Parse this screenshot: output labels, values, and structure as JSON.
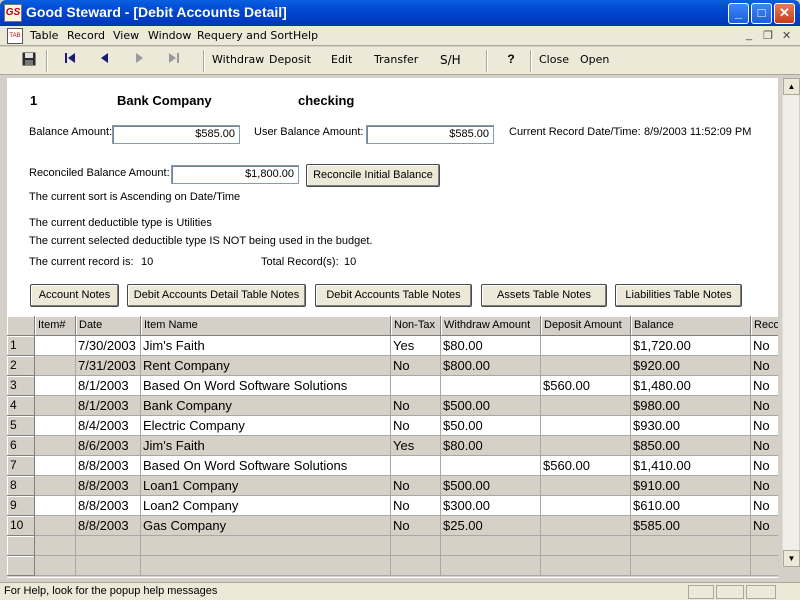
{
  "window": {
    "title": "Good Steward - [Debit Accounts Detail]",
    "icon_text": "GS"
  },
  "menu": [
    "Table",
    "Record",
    "View",
    "Window",
    "Requery and Sort",
    "Help"
  ],
  "toolbar": {
    "withdraw": "Withdraw",
    "deposit": "Deposit",
    "edit": "Edit",
    "transfer": "Transfer",
    "sh": "S/H",
    "close": "Close",
    "open": "Open"
  },
  "header": {
    "record_no": "1",
    "account_name": "Bank Company",
    "account_type": "checking"
  },
  "balances": {
    "balance_label": "Balance Amount:",
    "balance_value": "$585.00",
    "user_balance_label": "User Balance Amount:",
    "user_balance_value": "$585.00",
    "current_date_label": "Current Record Date/Time:",
    "current_date_value": "8/9/2003 11:52:09 PM",
    "reconciled_label": "Reconciled Balance Amount:",
    "reconciled_value": "$1,800.00",
    "reconcile_button": "Reconcile Initial Balance"
  },
  "info": {
    "sort_prefix": "The current sort is",
    "sort_order": "Ascending",
    "sort_on": "on",
    "sort_field": "Date/Time",
    "deductible_prefix": "The current deductible type is",
    "deductible_type": "Utilities",
    "budget_note": "The current selected deductible type IS NOT being used in the budget.",
    "current_record_label": "The current record is:",
    "current_record_value": "10",
    "total_records_label": "Total Record(s):",
    "total_records_value": "10"
  },
  "notes_buttons": [
    "Account Notes",
    "Debit Accounts Detail Table Notes",
    "Debit Accounts Table Notes",
    "Assets Table Notes",
    "Liabilities Table Notes"
  ],
  "grid": {
    "columns": [
      "Item#",
      "Date",
      "Item Name",
      "Non-Tax",
      "Withdraw Amount",
      "Deposit Amount",
      "Balance",
      "Reco"
    ],
    "rows": [
      {
        "n": "1",
        "item": "",
        "date": "7/30/2003",
        "name": "Jim's Faith",
        "nontax": "Yes",
        "withdraw": "$80.00",
        "deposit": "",
        "balance": "$1,720.00",
        "reco": "No"
      },
      {
        "n": "2",
        "item": "",
        "date": "7/31/2003",
        "name": "Rent Company",
        "nontax": "No",
        "withdraw": "$800.00",
        "deposit": "",
        "balance": "$920.00",
        "reco": "No"
      },
      {
        "n": "3",
        "item": "",
        "date": "8/1/2003",
        "name": "Based On Word Software Solutions",
        "nontax": "",
        "withdraw": "",
        "deposit": "$560.00",
        "balance": "$1,480.00",
        "reco": "No"
      },
      {
        "n": "4",
        "item": "",
        "date": "8/1/2003",
        "name": "Bank Company",
        "nontax": "No",
        "withdraw": "$500.00",
        "deposit": "",
        "balance": "$980.00",
        "reco": "No"
      },
      {
        "n": "5",
        "item": "",
        "date": "8/4/2003",
        "name": "Electric Company",
        "nontax": "No",
        "withdraw": "$50.00",
        "deposit": "",
        "balance": "$930.00",
        "reco": "No"
      },
      {
        "n": "6",
        "item": "",
        "date": "8/6/2003",
        "name": "Jim's Faith",
        "nontax": "Yes",
        "withdraw": "$80.00",
        "deposit": "",
        "balance": "$850.00",
        "reco": "No"
      },
      {
        "n": "7",
        "item": "",
        "date": "8/8/2003",
        "name": "Based On Word Software Solutions",
        "nontax": "",
        "withdraw": "",
        "deposit": "$560.00",
        "balance": "$1,410.00",
        "reco": "No"
      },
      {
        "n": "8",
        "item": "",
        "date": "8/8/2003",
        "name": "Loan1 Company",
        "nontax": "No",
        "withdraw": "$500.00",
        "deposit": "",
        "balance": "$910.00",
        "reco": "No"
      },
      {
        "n": "9",
        "item": "",
        "date": "8/8/2003",
        "name": "Loan2 Company",
        "nontax": "No",
        "withdraw": "$300.00",
        "deposit": "",
        "balance": "$610.00",
        "reco": "No"
      },
      {
        "n": "10",
        "item": "",
        "date": "8/8/2003",
        "name": "Gas Company",
        "nontax": "No",
        "withdraw": "$25.00",
        "deposit": "",
        "balance": "$585.00",
        "reco": "No"
      }
    ]
  },
  "status": {
    "text": "For Help, look for the popup help messages"
  },
  "colors": {
    "alt_row": "#d6d0c6",
    "white_row": "#ffffff",
    "title_blue": "#0045cf"
  }
}
